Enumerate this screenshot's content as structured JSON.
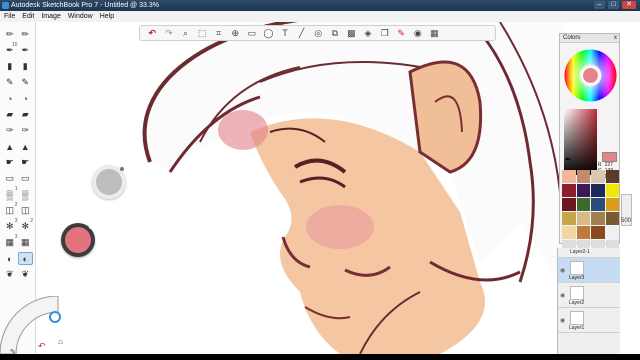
{
  "window": {
    "title": "Autodesk SketchBook Pro 7 - Untitled @ 33.3%",
    "minimize_label": "–",
    "maximize_label": "□",
    "close_label": "✕"
  },
  "menu": {
    "items": [
      "File",
      "Edit",
      "Image",
      "Window",
      "Help"
    ]
  },
  "toolbar": {
    "icons": [
      "undo-icon",
      "redo-icon",
      "zoom-icon",
      "select-icon",
      "crop-icon",
      "transform-icon",
      "ruler-icon",
      "ellipse-icon",
      "text-icon",
      "line-icon",
      "curve-icon",
      "symmetry-icon",
      "fill-icon",
      "perspective-icon",
      "layer-icon",
      "brush-icon",
      "color-wheel-icon",
      "lagoon-icon"
    ]
  },
  "brush_palette": {
    "brushes": [
      {
        "icon": "pencil-icon",
        "num": ""
      },
      {
        "icon": "pencil-icon",
        "num": ""
      },
      {
        "icon": "pen-icon",
        "num": "15"
      },
      {
        "icon": "pen-icon",
        "num": ""
      },
      {
        "icon": "marker-icon",
        "num": ""
      },
      {
        "icon": "marker-icon",
        "num": ""
      },
      {
        "icon": "brush-icon",
        "num": ""
      },
      {
        "icon": "brush-icon",
        "num": ""
      },
      {
        "icon": "airbrush-icon",
        "num": ""
      },
      {
        "icon": "airbrush-icon",
        "num": ""
      },
      {
        "icon": "chisel-icon",
        "num": ""
      },
      {
        "icon": "chisel-icon",
        "num": ""
      },
      {
        "icon": "ink-icon",
        "num": ""
      },
      {
        "icon": "ink-icon",
        "num": ""
      },
      {
        "icon": "paint-icon",
        "num": ""
      },
      {
        "icon": "paint-icon",
        "num": ""
      },
      {
        "icon": "smudge-icon",
        "num": ""
      },
      {
        "icon": "smudge-icon",
        "num": ""
      },
      {
        "icon": "eraser-icon",
        "num": ""
      },
      {
        "icon": "eraser-icon",
        "num": ""
      },
      {
        "icon": "texture-icon",
        "num": "1"
      },
      {
        "icon": "texture-icon",
        "num": ""
      },
      {
        "icon": "stamp-icon",
        "num": "2"
      },
      {
        "icon": "stamp-icon",
        "num": ""
      },
      {
        "icon": "splatter-icon",
        "num": "3"
      },
      {
        "icon": "splatter-icon",
        "num": "2"
      },
      {
        "icon": "pattern-icon",
        "num": "3"
      },
      {
        "icon": "pattern-icon",
        "num": ""
      },
      {
        "icon": "blend-icon",
        "num": ""
      },
      {
        "icon": "blend-icon",
        "num": ""
      },
      {
        "icon": "leaf-icon",
        "num": ""
      },
      {
        "icon": "leaf-icon",
        "num": ""
      }
    ]
  },
  "brush_puck": {
    "color": "#c8c8c8"
  },
  "color_puck": {
    "color": "#e3737e"
  },
  "colors_panel": {
    "title": "Colors",
    "close_label": "x",
    "rgb": {
      "r_label": "R",
      "r": "227",
      "g_label": "G",
      "g": "130",
      "b_label": "B",
      "b": "135"
    },
    "current_color": "#e5848a",
    "swatches": [
      "#f2b79a",
      "#c5896d",
      "#d8c8b2",
      "#5a3b2c",
      "#8c1f2b",
      "#3b1a57",
      "#1c2a5a",
      "#f0e60c",
      "#6b1620",
      "#3b6b2a",
      "#2c4a7a",
      "#d99a1e",
      "#c8a44a",
      "#d9b98a",
      "#a08050",
      "#7a5a30",
      "#f0d8a0",
      "#c07a3a",
      "#8a4a20",
      "#f0f0f0"
    ]
  },
  "layers": {
    "header": "Layer2-1",
    "items": [
      {
        "name": "Layer3",
        "active": true
      },
      {
        "name": "Layer2",
        "active": false
      },
      {
        "name": "Layer1",
        "active": false
      }
    ]
  },
  "status": {
    "zoom_readout": "500"
  },
  "lagoon": {
    "colors": [
      "#c22",
      "#3b8de0"
    ]
  }
}
